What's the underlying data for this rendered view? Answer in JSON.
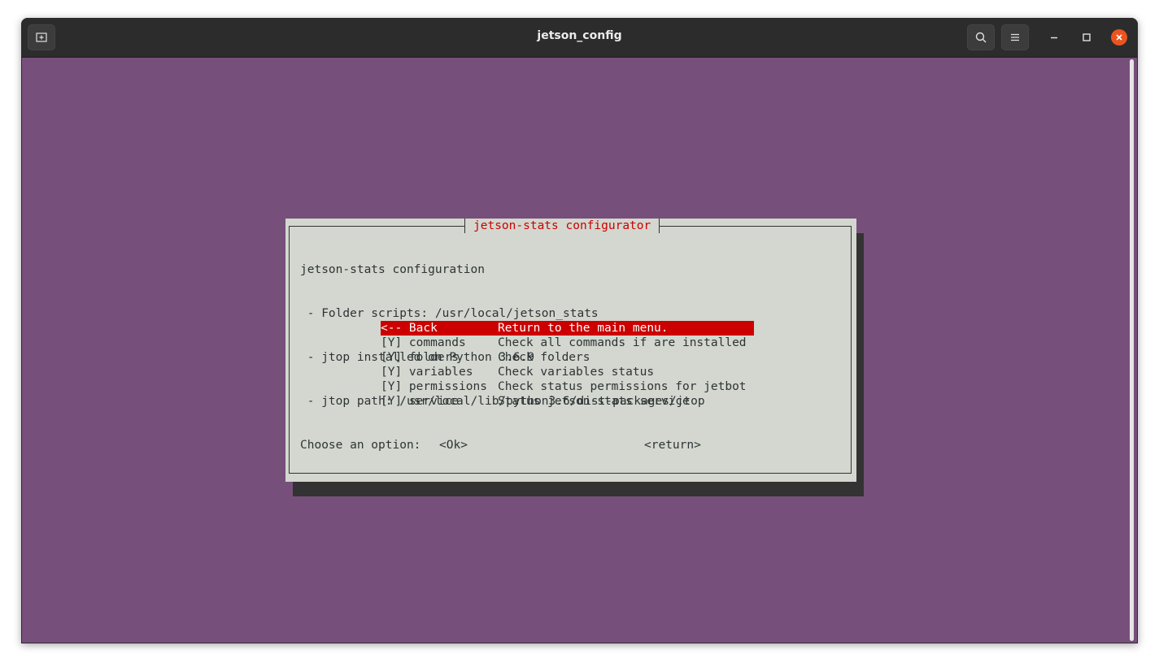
{
  "window": {
    "title": "jetson_config"
  },
  "icons": {
    "new_tab": "new-tab-icon",
    "search": "search-icon",
    "menu": "hamburger-menu-icon",
    "minimize": "minimize-icon",
    "maximize": "maximize-icon",
    "close": "close-icon"
  },
  "colors": {
    "terminal_bg": "#76507a",
    "dialog_bg": "#d3d7cf",
    "highlight": "#cc0000",
    "close_button": "#e95420"
  },
  "dialog": {
    "title": "jetson-stats configurator",
    "lines": [
      "jetson-stats configuration",
      " - Folder scripts: /usr/local/jetson_stats",
      " - jtop installed on Python 3.6.9",
      " - jtop path: /usr/local/lib/python3.6/dist-packages/jtop",
      "Choose an option:"
    ],
    "items": [
      {
        "tag": "<-- Back",
        "desc": "Return to the main menu."
      },
      {
        "tag": "[Y] commands",
        "desc": "Check all commands if are installed"
      },
      {
        "tag": "[Y] folders",
        "desc": "Check folders"
      },
      {
        "tag": "[Y] variables",
        "desc": "Check variables status"
      },
      {
        "tag": "[Y] permissions",
        "desc": "Check status permissions for jetbot"
      },
      {
        "tag": "[Y] service",
        "desc": "Status jetson-stats service"
      }
    ],
    "ok_label": "<Ok>",
    "return_label": "<return>"
  }
}
